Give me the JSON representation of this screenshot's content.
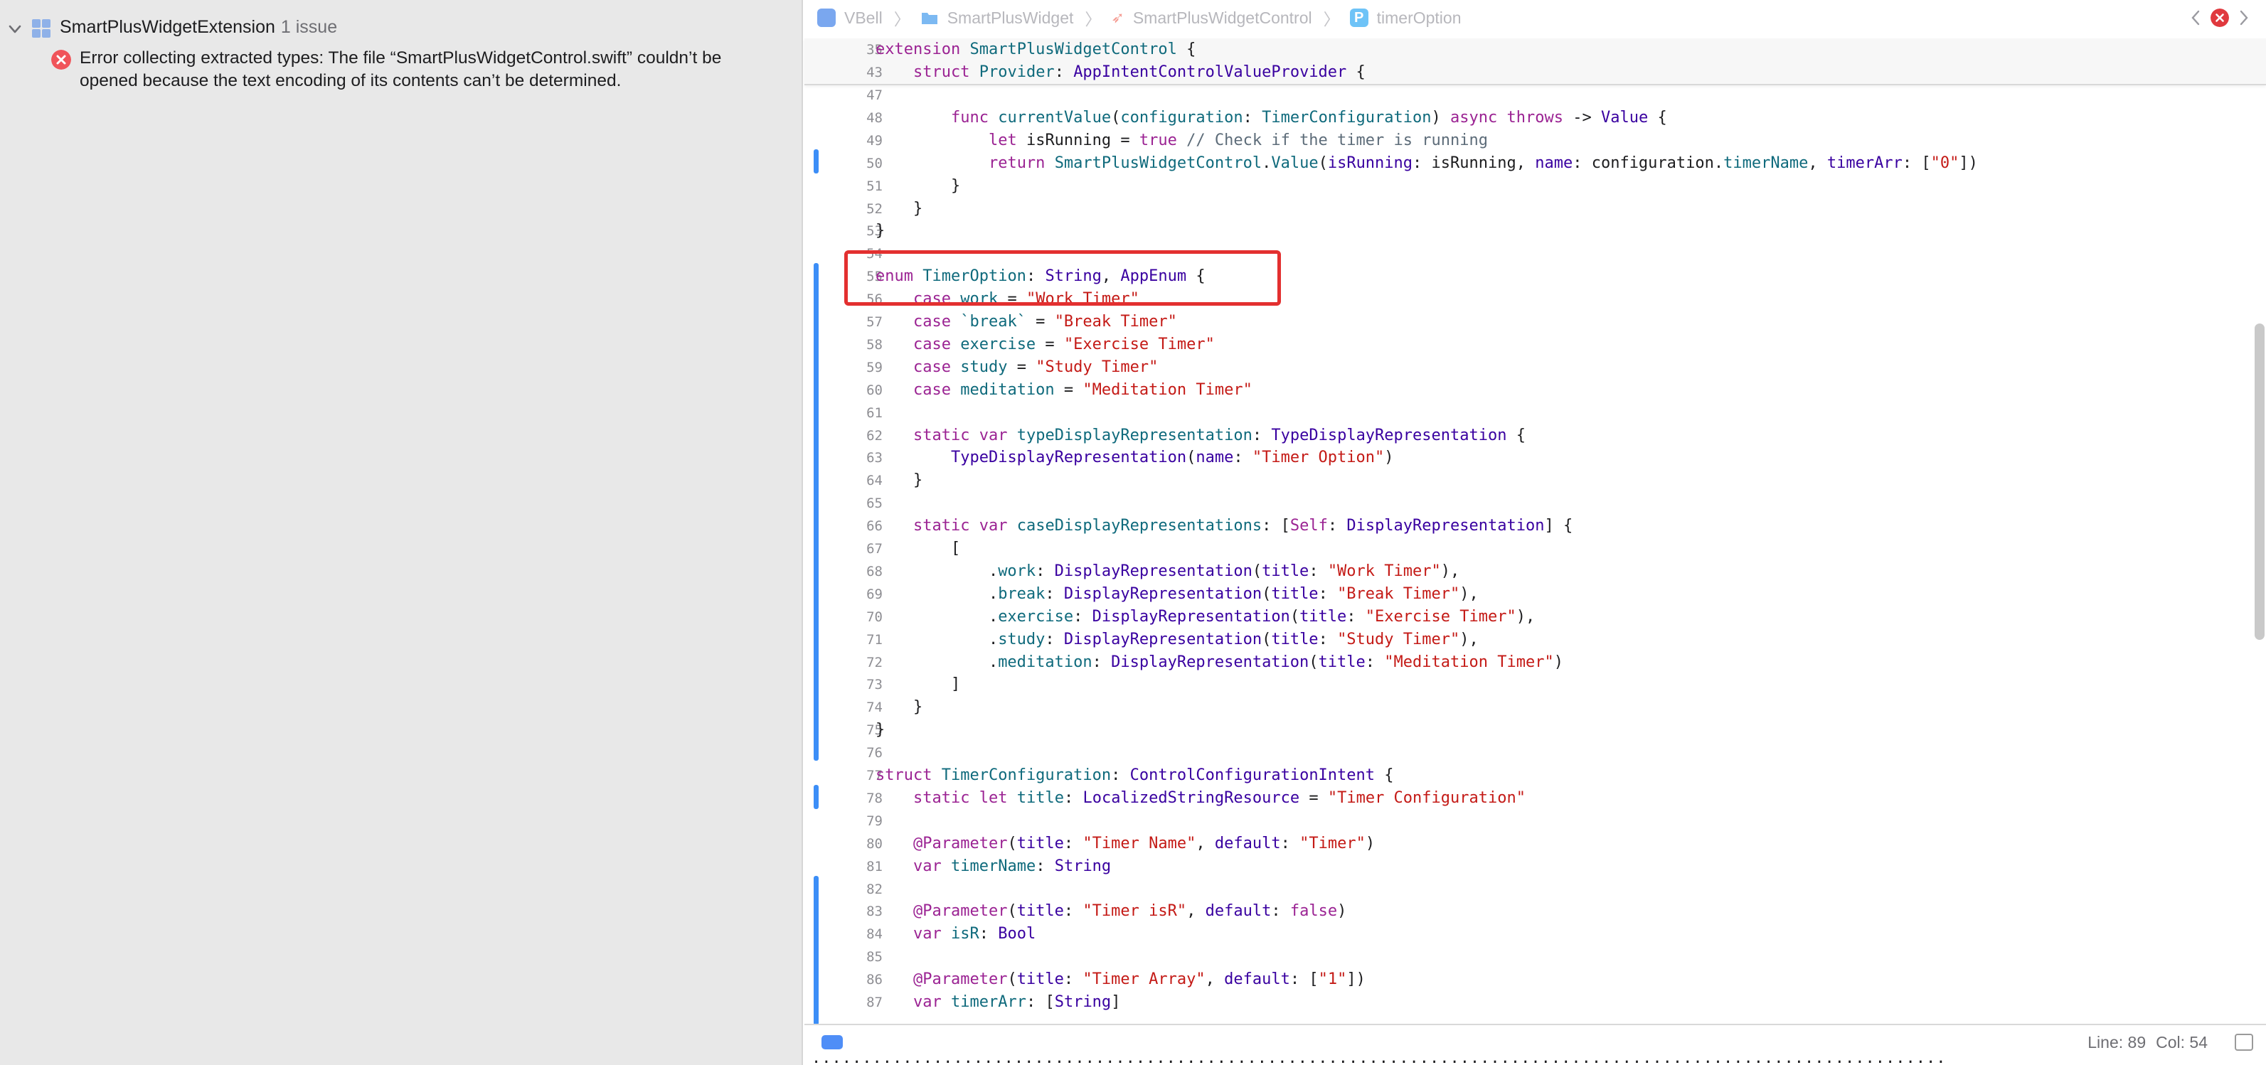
{
  "colors": {
    "keyword": "#9b2393",
    "type": "#3900a0",
    "project": "#0f6a7c",
    "string": "#c41a16",
    "comment": "#5d6c79",
    "plain": "#1d1d1f",
    "number": "#1c00cf",
    "error": "#f0545a",
    "change_bar": "#3c8ef7",
    "highlight_box": "#e33030"
  },
  "issues": {
    "group_title": "SmartPlusWidgetExtension",
    "group_count": "1 issue",
    "items": [
      {
        "icon": "error-icon",
        "message": "Error collecting extracted types: The file “SmartPlusWidgetControl.swift” couldn’t be opened because the text encoding of its contents can’t be determined."
      }
    ]
  },
  "jumpbar": {
    "items": [
      {
        "icon": "app-icon",
        "label": "VBell"
      },
      {
        "icon": "folder-icon",
        "label": "SmartPlusWidget"
      },
      {
        "icon": "swift-file-icon",
        "label": "SmartPlusWidgetControl"
      },
      {
        "icon": "property-icon",
        "label": "timerOption",
        "badge": "P"
      }
    ]
  },
  "editor": {
    "sticky_lines": [
      {
        "num": "35",
        "tokens": [
          [
            "k",
            "extension"
          ],
          [
            "p",
            " "
          ],
          [
            "j",
            "SmartPlusWidgetControl"
          ],
          [
            "p",
            " {"
          ]
        ]
      },
      {
        "num": "43",
        "tokens": [
          [
            "p",
            "    "
          ],
          [
            "k",
            "struct"
          ],
          [
            "p",
            " "
          ],
          [
            "j",
            "Provider"
          ],
          [
            "p",
            ": "
          ],
          [
            "t",
            "AppIntentControlValueProvider"
          ],
          [
            "p",
            " {"
          ]
        ]
      }
    ],
    "lines": [
      {
        "num": "47",
        "tokens": []
      },
      {
        "num": "48",
        "tokens": [
          [
            "p",
            "        "
          ],
          [
            "k",
            "func"
          ],
          [
            "p",
            " "
          ],
          [
            "j",
            "currentValue"
          ],
          [
            "p",
            "("
          ],
          [
            "j",
            "configuration"
          ],
          [
            "p",
            ": "
          ],
          [
            "j",
            "TimerConfiguration"
          ],
          [
            "p",
            ") "
          ],
          [
            "k",
            "async"
          ],
          [
            "p",
            " "
          ],
          [
            "k",
            "throws"
          ],
          [
            "p",
            " -> "
          ],
          [
            "t",
            "Value"
          ],
          [
            "p",
            " {"
          ]
        ]
      },
      {
        "num": "49",
        "tokens": [
          [
            "p",
            "            "
          ],
          [
            "k",
            "let"
          ],
          [
            "p",
            " isRunning = "
          ],
          [
            "k",
            "true"
          ],
          [
            "p",
            " "
          ],
          [
            "c",
            "// Check if the timer is running"
          ]
        ]
      },
      {
        "num": "50",
        "tokens": [
          [
            "p",
            "            "
          ],
          [
            "k",
            "return"
          ],
          [
            "p",
            " "
          ],
          [
            "j",
            "SmartPlusWidgetControl"
          ],
          [
            "p",
            "."
          ],
          [
            "j",
            "Value"
          ],
          [
            "p",
            "("
          ],
          [
            "t",
            "isRunning"
          ],
          [
            "p",
            ": isRunning, "
          ],
          [
            "t",
            "name"
          ],
          [
            "p",
            ": configuration."
          ],
          [
            "j",
            "timerName"
          ],
          [
            "p",
            ", "
          ],
          [
            "t",
            "timerArr"
          ],
          [
            "p",
            ": ["
          ],
          [
            "s",
            "\"0\""
          ],
          [
            "p",
            "])"
          ]
        ]
      },
      {
        "num": "51",
        "tokens": [
          [
            "p",
            "        }"
          ]
        ]
      },
      {
        "num": "52",
        "tokens": [
          [
            "p",
            "    }"
          ]
        ]
      },
      {
        "num": "53",
        "tokens": [
          [
            "p",
            "}"
          ]
        ]
      },
      {
        "num": "54",
        "tokens": []
      },
      {
        "num": "55",
        "tokens": [
          [
            "k",
            "enum"
          ],
          [
            "p",
            " "
          ],
          [
            "j",
            "TimerOption"
          ],
          [
            "p",
            ": "
          ],
          [
            "t",
            "String"
          ],
          [
            "p",
            ", "
          ],
          [
            "t",
            "AppEnum"
          ],
          [
            "p",
            " {"
          ]
        ]
      },
      {
        "num": "56",
        "tokens": [
          [
            "p",
            "    "
          ],
          [
            "k",
            "case"
          ],
          [
            "p",
            " "
          ],
          [
            "j",
            "work"
          ],
          [
            "p",
            " = "
          ],
          [
            "s",
            "\"Work Timer\""
          ]
        ]
      },
      {
        "num": "57",
        "tokens": [
          [
            "p",
            "    "
          ],
          [
            "k",
            "case"
          ],
          [
            "p",
            " "
          ],
          [
            "j",
            "`break`"
          ],
          [
            "p",
            " = "
          ],
          [
            "s",
            "\"Break Timer\""
          ]
        ]
      },
      {
        "num": "58",
        "tokens": [
          [
            "p",
            "    "
          ],
          [
            "k",
            "case"
          ],
          [
            "p",
            " "
          ],
          [
            "j",
            "exercise"
          ],
          [
            "p",
            " = "
          ],
          [
            "s",
            "\"Exercise Timer\""
          ]
        ]
      },
      {
        "num": "59",
        "tokens": [
          [
            "p",
            "    "
          ],
          [
            "k",
            "case"
          ],
          [
            "p",
            " "
          ],
          [
            "j",
            "study"
          ],
          [
            "p",
            " = "
          ],
          [
            "s",
            "\"Study Timer\""
          ]
        ]
      },
      {
        "num": "60",
        "tokens": [
          [
            "p",
            "    "
          ],
          [
            "k",
            "case"
          ],
          [
            "p",
            " "
          ],
          [
            "j",
            "meditation"
          ],
          [
            "p",
            " = "
          ],
          [
            "s",
            "\"Meditation Timer\""
          ]
        ]
      },
      {
        "num": "61",
        "tokens": []
      },
      {
        "num": "62",
        "tokens": [
          [
            "p",
            "    "
          ],
          [
            "k",
            "static"
          ],
          [
            "p",
            " "
          ],
          [
            "k",
            "var"
          ],
          [
            "p",
            " "
          ],
          [
            "j",
            "typeDisplayRepresentation"
          ],
          [
            "p",
            ": "
          ],
          [
            "t",
            "TypeDisplayRepresentation"
          ],
          [
            "p",
            " {"
          ]
        ]
      },
      {
        "num": "63",
        "tokens": [
          [
            "p",
            "        "
          ],
          [
            "t",
            "TypeDisplayRepresentation"
          ],
          [
            "p",
            "("
          ],
          [
            "t",
            "name"
          ],
          [
            "p",
            ": "
          ],
          [
            "s",
            "\"Timer Option\""
          ],
          [
            "p",
            ")"
          ]
        ]
      },
      {
        "num": "64",
        "tokens": [
          [
            "p",
            "    }"
          ]
        ]
      },
      {
        "num": "65",
        "tokens": []
      },
      {
        "num": "66",
        "tokens": [
          [
            "p",
            "    "
          ],
          [
            "k",
            "static"
          ],
          [
            "p",
            " "
          ],
          [
            "k",
            "var"
          ],
          [
            "p",
            " "
          ],
          [
            "j",
            "caseDisplayRepresentations"
          ],
          [
            "p",
            ": ["
          ],
          [
            "k",
            "Self"
          ],
          [
            "p",
            ": "
          ],
          [
            "t",
            "DisplayRepresentation"
          ],
          [
            "p",
            "] {"
          ]
        ]
      },
      {
        "num": "67",
        "tokens": [
          [
            "p",
            "        ["
          ]
        ]
      },
      {
        "num": "68",
        "tokens": [
          [
            "p",
            "            ."
          ],
          [
            "j",
            "work"
          ],
          [
            "p",
            ": "
          ],
          [
            "t",
            "DisplayRepresentation"
          ],
          [
            "p",
            "("
          ],
          [
            "t",
            "title"
          ],
          [
            "p",
            ": "
          ],
          [
            "s",
            "\"Work Timer\""
          ],
          [
            "p",
            "),"
          ]
        ]
      },
      {
        "num": "69",
        "tokens": [
          [
            "p",
            "            ."
          ],
          [
            "j",
            "break"
          ],
          [
            "p",
            ": "
          ],
          [
            "t",
            "DisplayRepresentation"
          ],
          [
            "p",
            "("
          ],
          [
            "t",
            "title"
          ],
          [
            "p",
            ": "
          ],
          [
            "s",
            "\"Break Timer\""
          ],
          [
            "p",
            "),"
          ]
        ]
      },
      {
        "num": "70",
        "tokens": [
          [
            "p",
            "            ."
          ],
          [
            "j",
            "exercise"
          ],
          [
            "p",
            ": "
          ],
          [
            "t",
            "DisplayRepresentation"
          ],
          [
            "p",
            "("
          ],
          [
            "t",
            "title"
          ],
          [
            "p",
            ": "
          ],
          [
            "s",
            "\"Exercise Timer\""
          ],
          [
            "p",
            "),"
          ]
        ]
      },
      {
        "num": "71",
        "tokens": [
          [
            "p",
            "            ."
          ],
          [
            "j",
            "study"
          ],
          [
            "p",
            ": "
          ],
          [
            "t",
            "DisplayRepresentation"
          ],
          [
            "p",
            "("
          ],
          [
            "t",
            "title"
          ],
          [
            "p",
            ": "
          ],
          [
            "s",
            "\"Study Timer\""
          ],
          [
            "p",
            "),"
          ]
        ]
      },
      {
        "num": "72",
        "tokens": [
          [
            "p",
            "            ."
          ],
          [
            "j",
            "meditation"
          ],
          [
            "p",
            ": "
          ],
          [
            "t",
            "DisplayRepresentation"
          ],
          [
            "p",
            "("
          ],
          [
            "t",
            "title"
          ],
          [
            "p",
            ": "
          ],
          [
            "s",
            "\"Meditation Timer\""
          ],
          [
            "p",
            ")"
          ]
        ]
      },
      {
        "num": "73",
        "tokens": [
          [
            "p",
            "        ]"
          ]
        ]
      },
      {
        "num": "74",
        "tokens": [
          [
            "p",
            "    }"
          ]
        ]
      },
      {
        "num": "75",
        "tokens": [
          [
            "p",
            "}"
          ]
        ]
      },
      {
        "num": "76",
        "tokens": []
      },
      {
        "num": "77",
        "tokens": [
          [
            "k",
            "struct"
          ],
          [
            "p",
            " "
          ],
          [
            "j",
            "TimerConfiguration"
          ],
          [
            "p",
            ": "
          ],
          [
            "t",
            "ControlConfigurationIntent"
          ],
          [
            "p",
            " {"
          ]
        ]
      },
      {
        "num": "78",
        "tokens": [
          [
            "p",
            "    "
          ],
          [
            "k",
            "static"
          ],
          [
            "p",
            " "
          ],
          [
            "k",
            "let"
          ],
          [
            "p",
            " "
          ],
          [
            "j",
            "title"
          ],
          [
            "p",
            ": "
          ],
          [
            "t",
            "LocalizedStringResource"
          ],
          [
            "p",
            " = "
          ],
          [
            "s",
            "\"Timer Configuration\""
          ]
        ]
      },
      {
        "num": "79",
        "tokens": []
      },
      {
        "num": "80",
        "tokens": [
          [
            "p",
            "    "
          ],
          [
            "k",
            "@Parameter"
          ],
          [
            "p",
            "("
          ],
          [
            "t",
            "title"
          ],
          [
            "p",
            ": "
          ],
          [
            "s",
            "\"Timer Name\""
          ],
          [
            "p",
            ", "
          ],
          [
            "t",
            "default"
          ],
          [
            "p",
            ": "
          ],
          [
            "s",
            "\"Timer\""
          ],
          [
            "p",
            ")"
          ]
        ]
      },
      {
        "num": "81",
        "tokens": [
          [
            "p",
            "    "
          ],
          [
            "k",
            "var"
          ],
          [
            "p",
            " "
          ],
          [
            "j",
            "timerName"
          ],
          [
            "p",
            ": "
          ],
          [
            "t",
            "String"
          ]
        ]
      },
      {
        "num": "82",
        "tokens": []
      },
      {
        "num": "83",
        "tokens": [
          [
            "p",
            "    "
          ],
          [
            "k",
            "@Parameter"
          ],
          [
            "p",
            "("
          ],
          [
            "t",
            "title"
          ],
          [
            "p",
            ": "
          ],
          [
            "s",
            "\"Timer isR\""
          ],
          [
            "p",
            ", "
          ],
          [
            "t",
            "default"
          ],
          [
            "p",
            ": "
          ],
          [
            "k",
            "false"
          ],
          [
            "p",
            ")"
          ]
        ]
      },
      {
        "num": "84",
        "tokens": [
          [
            "p",
            "    "
          ],
          [
            "k",
            "var"
          ],
          [
            "p",
            " "
          ],
          [
            "j",
            "isR"
          ],
          [
            "p",
            ": "
          ],
          [
            "t",
            "Bool"
          ]
        ]
      },
      {
        "num": "85",
        "tokens": []
      },
      {
        "num": "86",
        "tokens": [
          [
            "p",
            "    "
          ],
          [
            "k",
            "@Parameter"
          ],
          [
            "p",
            "("
          ],
          [
            "t",
            "title"
          ],
          [
            "p",
            ": "
          ],
          [
            "s",
            "\"Timer Array\""
          ],
          [
            "p",
            ", "
          ],
          [
            "t",
            "default"
          ],
          [
            "p",
            ": ["
          ],
          [
            "s",
            "\"1\""
          ],
          [
            "p",
            "])"
          ]
        ]
      },
      {
        "num": "87",
        "tokens": [
          [
            "p",
            "    "
          ],
          [
            "k",
            "var"
          ],
          [
            "p",
            " "
          ],
          [
            "j",
            "timerArr"
          ],
          [
            "p",
            ": ["
          ],
          [
            "t",
            "String"
          ],
          [
            "p",
            "]"
          ]
        ]
      }
    ]
  },
  "statusbar": {
    "line_label": "Line: 89",
    "col_label": "Col: 54"
  }
}
